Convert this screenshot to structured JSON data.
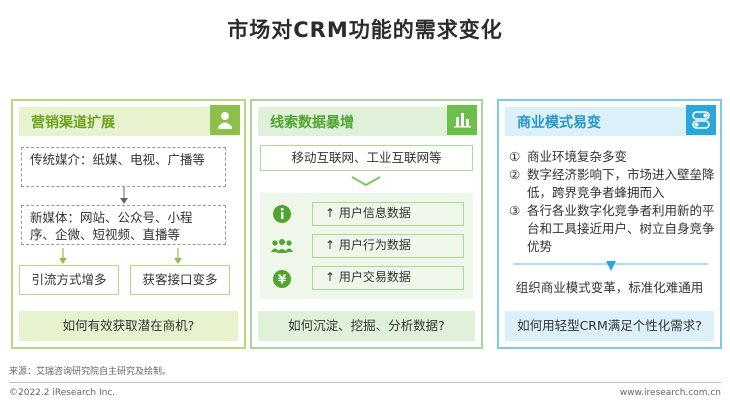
{
  "title": "市场对CRM功能的需求变化",
  "colors": {
    "green_light": "#b6d97a",
    "green": "#a8d89a",
    "blue": "#7dcbe8"
  },
  "panel1": {
    "header": "营销渠道扩展",
    "icon": "person-icon",
    "traditional": "传统媒介：纸媒、电视、广播等",
    "new_media": "新媒体：网站、公众号、小程序、企微、短视频、直播等",
    "box_left": "引流方式增多",
    "box_right": "获客接口变多",
    "question": "如何有效获取潜在商机?"
  },
  "panel2": {
    "header": "线索数据暴增",
    "icon": "bar-chart-icon",
    "top": "移动互联网、工业互联网等",
    "rows": [
      {
        "icon": "info-icon",
        "text": "↑  用户信息数据"
      },
      {
        "icon": "people-icon",
        "text": "↑  用户行为数据"
      },
      {
        "icon": "yen-icon",
        "text": "↑  用户交易数据"
      }
    ],
    "question": "如何沉淀、挖掘、分析数据?"
  },
  "panel3": {
    "header": "商业模式易变",
    "icon": "toggle-icon",
    "items": [
      {
        "num": "①",
        "text": "商业环境复杂多变"
      },
      {
        "num": "②",
        "text": "数字经济影响下，市场进入壁垒降低，跨界竞争者蜂拥而入"
      },
      {
        "num": "③",
        "text": "各行各业数字化竞争者利用新的平台和工具接近用户、树立自身竞争优势"
      }
    ],
    "result": "组织商业模式变革，标准化难通用",
    "question": "如何用轻型CRM满足个性化需求?"
  },
  "footer": {
    "source": "来源：艾瑞咨询研究院自主研究及绘制。",
    "copyright": "©2022.2 iResearch Inc.",
    "url": "www.iresearch.com.cn"
  }
}
